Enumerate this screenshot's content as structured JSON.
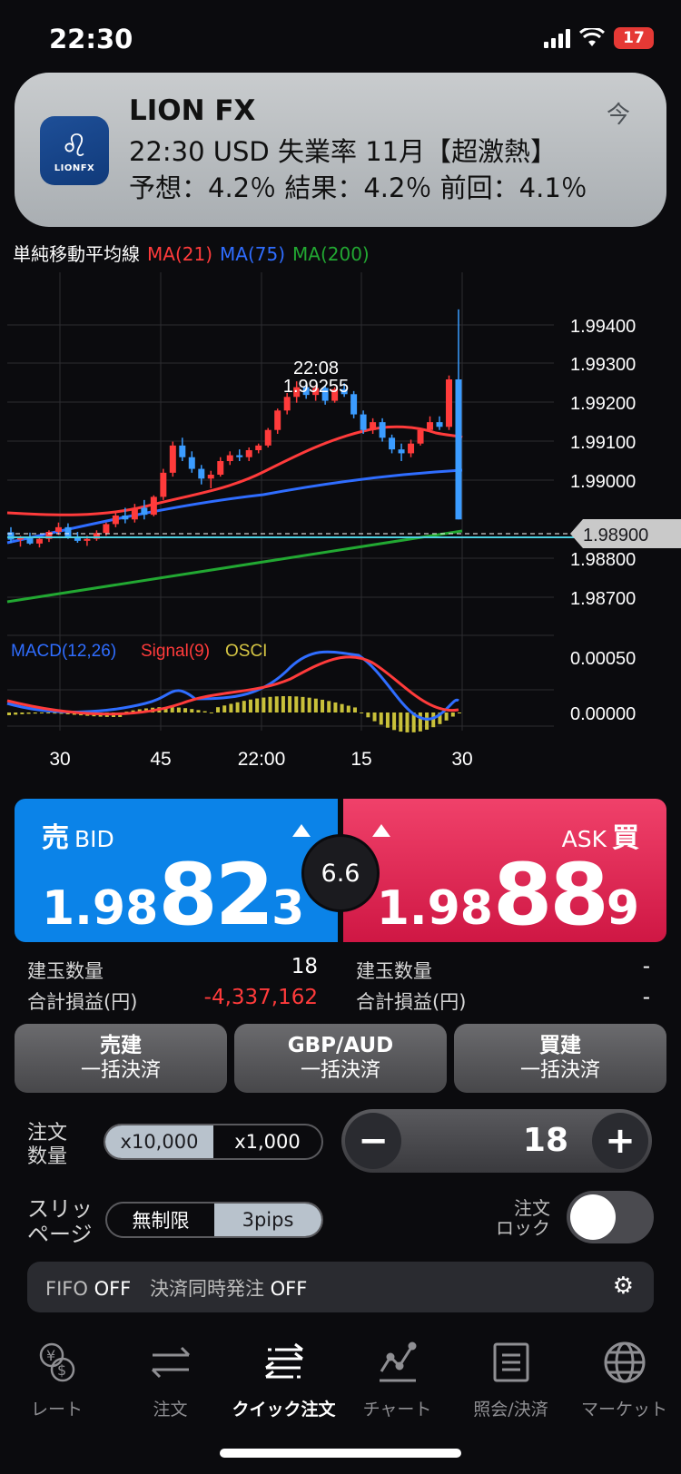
{
  "status": {
    "time": "22:30",
    "battery": "17"
  },
  "notification": {
    "app": "LION FX",
    "logo_text": "LIONFX",
    "time": "今",
    "line1": "22:30 USD 失業率 11月【超激熱】",
    "line2": "予想：4.2％ 結果：4.2％ 前回：4.1％"
  },
  "ma_legend": {
    "title": "単純移動平均線",
    "ma21": "MA(21)",
    "ma75": "MA(75)",
    "ma200": "MA(200)",
    "colors": {
      "ma21": "#ff3b3b",
      "ma75": "#2f6dff",
      "ma200": "#22a832"
    }
  },
  "chart_data": {
    "type": "candlestick",
    "price_ticks": [
      "1.99400",
      "1.99300",
      "1.99200",
      "1.99100",
      "1.99000",
      "1.98800",
      "1.98700"
    ],
    "current_price_label": "1.98900",
    "high_annotation": {
      "time": "22:08",
      "price": "1.99255"
    },
    "macd_legend": {
      "macd": "MACD(12,26)",
      "signal": "Signal(9)",
      "osci": "OSCI"
    },
    "macd_ticks": [
      "0.00050",
      "0.00000"
    ],
    "x_ticks": [
      "30",
      "45",
      "22:00",
      "15",
      "30"
    ],
    "candles": [
      [
        1.98867,
        1.9888,
        1.9884,
        1.98848
      ],
      [
        1.98848,
        1.98858,
        1.9883,
        1.98853
      ],
      [
        1.98853,
        1.98866,
        1.98835,
        1.98838
      ],
      [
        1.98838,
        1.98855,
        1.98828,
        1.9885
      ],
      [
        1.9885,
        1.98872,
        1.98842,
        1.98868
      ],
      [
        1.98868,
        1.98892,
        1.9886,
        1.9888
      ],
      [
        1.9888,
        1.9889,
        1.9885,
        1.98855
      ],
      [
        1.98855,
        1.98868,
        1.9884,
        1.98845
      ],
      [
        1.98845,
        1.98858,
        1.98832,
        1.9885
      ],
      [
        1.9885,
        1.98872,
        1.98845,
        1.98865
      ],
      [
        1.98865,
        1.98892,
        1.98858,
        1.98888
      ],
      [
        1.98888,
        1.98918,
        1.9888,
        1.9891
      ],
      [
        1.9891,
        1.9893,
        1.9889,
        1.989
      ],
      [
        1.989,
        1.9894,
        1.98892,
        1.9893
      ],
      [
        1.9893,
        1.9895,
        1.989,
        1.98912
      ],
      [
        1.98912,
        1.98962,
        1.98908,
        1.98958
      ],
      [
        1.98958,
        1.9903,
        1.9895,
        1.9902
      ],
      [
        1.9902,
        1.991,
        1.9901,
        1.9909
      ],
      [
        1.9909,
        1.9911,
        1.9905,
        1.9906
      ],
      [
        1.9906,
        1.99075,
        1.9902,
        1.9903
      ],
      [
        1.9903,
        1.9904,
        1.9899,
        1.99005
      ],
      [
        1.99005,
        1.99025,
        1.9898,
        1.99015
      ],
      [
        1.99015,
        1.9906,
        1.9901,
        1.9905
      ],
      [
        1.9905,
        1.99075,
        1.9904,
        1.99065
      ],
      [
        1.99065,
        1.9908,
        1.9905,
        1.9906
      ],
      [
        1.9906,
        1.99085,
        1.9905,
        1.99078
      ],
      [
        1.99078,
        1.99095,
        1.9907,
        1.9909
      ],
      [
        1.9909,
        1.99135,
        1.99085,
        1.9913
      ],
      [
        1.9913,
        1.99185,
        1.9912,
        1.9918
      ],
      [
        1.9918,
        1.99225,
        1.9917,
        1.99215
      ],
      [
        1.99215,
        1.99255,
        1.992,
        1.9924
      ],
      [
        1.9924,
        1.9925,
        1.9921,
        1.9922
      ],
      [
        1.9922,
        1.99245,
        1.99205,
        1.99238
      ],
      [
        1.99238,
        1.99245,
        1.99195,
        1.99205
      ],
      [
        1.99205,
        1.9924,
        1.992,
        1.99235
      ],
      [
        1.99235,
        1.9925,
        1.99215,
        1.99222
      ],
      [
        1.99222,
        1.9923,
        1.9916,
        1.9917
      ],
      [
        1.9917,
        1.9918,
        1.9912,
        1.9913
      ],
      [
        1.9913,
        1.9916,
        1.9912,
        1.9915
      ],
      [
        1.9915,
        1.9916,
        1.991,
        1.9911
      ],
      [
        1.9911,
        1.99118,
        1.9907,
        1.9908
      ],
      [
        1.9908,
        1.99095,
        1.9905,
        1.9907
      ],
      [
        1.9907,
        1.99105,
        1.9906,
        1.99095
      ],
      [
        1.99095,
        1.99135,
        1.9909,
        1.9913
      ],
      [
        1.9913,
        1.99165,
        1.99125,
        1.9915
      ],
      [
        1.9915,
        1.99165,
        1.9913,
        1.99138
      ],
      [
        1.99138,
        1.9927,
        1.9913,
        1.9926
      ],
      [
        1.9926,
        1.9944,
        1.989,
        1.989
      ]
    ]
  },
  "bid": {
    "label": "売",
    "sublabel": "BID",
    "prefix": "1.98",
    "big": "82",
    "last": "3"
  },
  "ask": {
    "label": "買",
    "sublabel": "ASK",
    "prefix": "1.98",
    "big": "88",
    "last": "9"
  },
  "spread": "6.6",
  "position": {
    "qty_label": "建玉数量",
    "pl_label": "合計損益(円)",
    "sell_qty": "18",
    "sell_pl": "-4,337,162",
    "buy_qty": "-",
    "buy_pl": "-"
  },
  "bulk": {
    "sell": {
      "l1": "売建",
      "l2": "一括決済"
    },
    "pair": {
      "l1": "GBP/AUD",
      "l2": "一括決済"
    },
    "buy": {
      "l1": "買建",
      "l2": "一括決済"
    }
  },
  "order_qty": {
    "label": "注文\n数量",
    "unit_on": "x10,000",
    "unit_off": "x1,000",
    "minus": "−",
    "plus": "+",
    "value": "18"
  },
  "slippage": {
    "label": "スリッ\nページ",
    "opt1": "無制限",
    "opt2": "3pips",
    "lock_label": "注文\nロック"
  },
  "fifo": {
    "fifo_label": "FIFO",
    "fifo_val": "OFF",
    "sim_label": "決済同時発注",
    "sim_val": "OFF"
  },
  "tabs": [
    {
      "label": "レート"
    },
    {
      "label": "注文"
    },
    {
      "label": "クイック注文"
    },
    {
      "label": "チャート"
    },
    {
      "label": "照会/決済"
    },
    {
      "label": "マーケット"
    }
  ]
}
